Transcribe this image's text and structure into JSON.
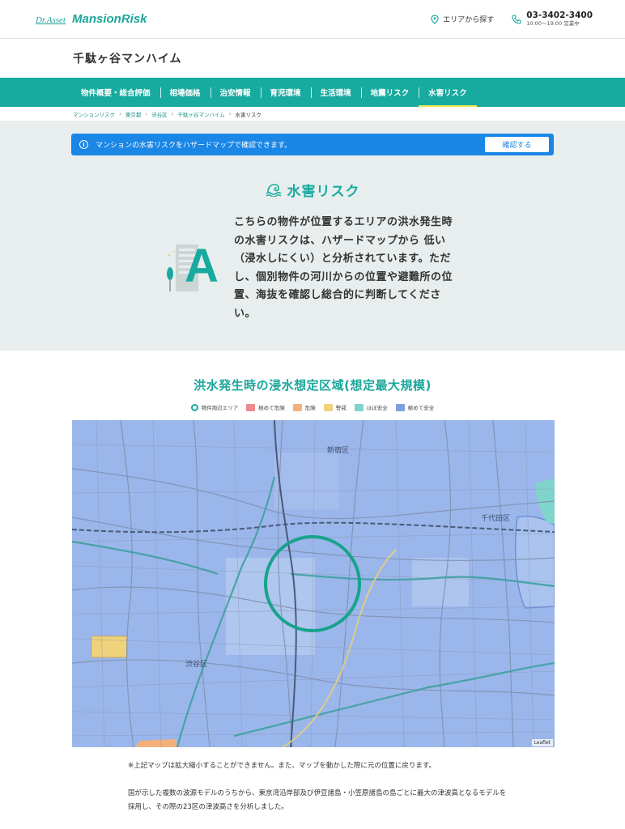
{
  "header": {
    "logo_prefix": "Dr.Asset",
    "logo_name": "MansionRisk",
    "area_search_label": "エリアから探す",
    "phone_number": "03-3402-3400",
    "phone_hours": "10:00〜19:00 営業中"
  },
  "property": {
    "title": "千駄ヶ谷マンハイム"
  },
  "tabs": [
    {
      "label": "物件概要・総合評価",
      "active": false
    },
    {
      "label": "相場価格",
      "active": false
    },
    {
      "label": "治安情報",
      "active": false
    },
    {
      "label": "育児環境",
      "active": false
    },
    {
      "label": "生活環境",
      "active": false
    },
    {
      "label": "地震リスク",
      "active": false
    },
    {
      "label": "水害リスク",
      "active": true
    }
  ],
  "breadcrumb": [
    "マンションリスク",
    "東京都",
    "渋谷区",
    "千駄ヶ谷マンハイム",
    "水害リスク"
  ],
  "notice": {
    "text": "マンションの水害リスクをハザードマップで確認できます。",
    "button_label": "確認する"
  },
  "risk": {
    "heading": "水害リスク",
    "grade": "A",
    "description": "こちらの物件が位置するエリアの洪水発生時の水害リスクは、ハザードマップから 低い（浸水しにくい）と分析されています。ただし、個別物件の河川からの位置や避難所の位置、海抜を確認し総合的に判断してください。"
  },
  "flood_map": {
    "title": "洪水発生時の浸水想定区域(想定最大規模)",
    "legend": [
      {
        "label": "物件周辺エリア",
        "type": "ring",
        "color": "#17aa9f"
      },
      {
        "label": "極めて危険",
        "color": "#f08a8a"
      },
      {
        "label": "危険",
        "color": "#f5b07a"
      },
      {
        "label": "警戒",
        "color": "#f0d27a"
      },
      {
        "label": "ほぼ安全",
        "color": "#7fd4cc"
      },
      {
        "label": "極めて安全",
        "color": "#7f9fe0"
      }
    ],
    "map_labels": [
      "新宿区",
      "千代田区",
      "渋谷区"
    ],
    "attribution": "Leaflet"
  },
  "note": "※上記マップは拡大縮小することができません。また、マップを動かした際に元の位置に戻ります。",
  "description": "国が示した複数の波源モデルのうちから、東京湾沿岸部及び伊豆諸島・小笠原諸島の島ごとに最大の津波高となるモデルを採用し、その際の23区の津波高さを分析しました。"
}
